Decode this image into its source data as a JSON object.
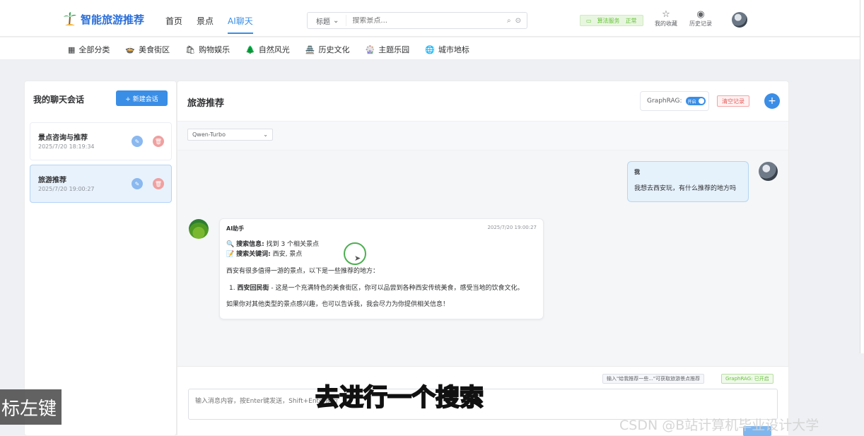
{
  "header": {
    "brand": "智能旅游推荐",
    "nav": [
      "首页",
      "景点",
      "AI聊天"
    ],
    "active_nav": "AI聊天",
    "search_type": "标题",
    "search_placeholder": "搜索景点...",
    "status_label": "算法服务",
    "status_value": "正常",
    "favorites_label": "我的收藏",
    "history_label": "历史记录"
  },
  "categories": [
    {
      "icon": "grid-icon",
      "glyph": "▦",
      "label": "全部分类"
    },
    {
      "icon": "food-icon",
      "glyph": "🍲",
      "label": "美食街区"
    },
    {
      "icon": "shopping-icon",
      "glyph": "🛍",
      "label": "购物娱乐"
    },
    {
      "icon": "nature-icon",
      "glyph": "🌲",
      "label": "自然风光"
    },
    {
      "icon": "history-icon",
      "glyph": "🏯",
      "label": "历史文化"
    },
    {
      "icon": "themepark-icon",
      "glyph": "🎡",
      "label": "主题乐园"
    },
    {
      "icon": "landmark-icon",
      "glyph": "🌐",
      "label": "城市地标"
    }
  ],
  "sidebar": {
    "title": "我的聊天会话",
    "new_chat": "+ 新建会话",
    "sessions": [
      {
        "name": "景点咨询与推荐",
        "time": "2025/7/20 18:19:34"
      },
      {
        "name": "旅游推荐",
        "time": "2025/7/20 19:00:27"
      }
    ]
  },
  "main": {
    "title": "旅游推荐",
    "graphrag_label": "GraphRAG:",
    "graphrag_toggle": "开启",
    "clear_label": "清空记录",
    "model": "Qwen-Turbo"
  },
  "chat": {
    "user_name": "我",
    "user_message": "我想去西安玩，有什么推荐的地方吗",
    "ai_name": "AI助手",
    "ai_time": "2025/7/20 19:00:27",
    "search_info_label": "搜索信息:",
    "search_info_value": "找到 3 个相关景点",
    "keywords_label": "搜索关键词:",
    "keywords_value": "西安, 景点",
    "intro": "西安有很多值得一游的景点，以下是一些推荐的地方：",
    "item_bold": "西安回民街",
    "item_text": " - 这是一个充满特色的美食街区，你可以品尝到各种西安传统美食，感受当地的饮食文化。",
    "item_number": "1.",
    "closing": "如果你对其他类型的景点感兴趣，也可以告诉我，我会尽力为你提供相关信息！"
  },
  "input": {
    "hint_tip": "输入\"给我推荐一些...\"可获取旅游景点推荐",
    "hint_graphrag": "GraphRAG: 已开启",
    "placeholder": "输入消息内容，按Enter键发送，Shift+Enter换行"
  },
  "overlays": {
    "subtitle": "去进行一个搜索",
    "left_caption": "标左键",
    "watermark": "CSDN @B站计算机毕业设计大学"
  },
  "colors": {
    "accent": "#3a8ee6",
    "danger": "#e35d5d",
    "success": "#67c23a"
  }
}
